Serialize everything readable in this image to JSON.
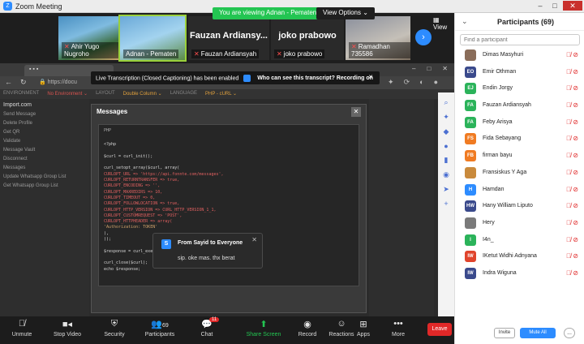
{
  "window": {
    "title": "Zoom Meeting"
  },
  "banner": {
    "viewing": "You are viewing Adnan - Pematen's screen",
    "view_options": "View Options ⌄"
  },
  "gallery": {
    "tiles": [
      {
        "name": "Ahir Yugo Nugroho"
      },
      {
        "name": "Adnan - Pematen"
      },
      {
        "name": "Fauzan Ardiansyah",
        "big": "Fauzan Ardiansy..."
      },
      {
        "name": "joko prabowo",
        "big": "joko prabowo"
      },
      {
        "name": "Ramadhan 735586"
      }
    ],
    "view_label": "View"
  },
  "caption": {
    "text": "Live Transcription (Closed Captioning) has been enabled",
    "link": "Who can see this transcript? Recording on"
  },
  "dialog": {
    "title": "Messages",
    "lang": "PHP",
    "code": [
      "<?php",
      "",
      "$curl = curl_init();",
      "",
      "curl_setopt_array($curl, array(",
      "  CURLOPT_URL => 'https://api.fonnte.com/messages',",
      "  CURLOPT_RETURNTRANSFER => true,",
      "  CURLOPT_ENCODING => '',",
      "  CURLOPT_MAXREDIRS => 10,",
      "  CURLOPT_TIMEOUT => 0,",
      "  CURLOPT_FOLLOWLOCATION => true,",
      "  CURLOPT_HTTP_VERSION => CURL_HTTP_VERSION_1_1,",
      "  CURLOPT_CUSTOMREQUEST => 'POST',",
      "  CURLOPT_HTTPHEADER => array(",
      "    'Authorization: TOKEN'",
      "  ),",
      "));",
      "",
      "$response = curl_exec($curl);",
      "",
      "curl_close($curl);",
      "echo $response;"
    ]
  },
  "postman_left": [
    "Import.com",
    "Send Message",
    "Delete Profile",
    "Get QR",
    "Validate",
    "Message Vault",
    "Disconnect",
    "Messages",
    "Update Whatsapp Group List",
    "Get Whatsapp Group List"
  ],
  "chat_toast": {
    "from": "From Sayid to Everyone",
    "message": "sip. oke mas. thx berat",
    "avatar": "S"
  },
  "toolbar": {
    "unmute": "Unmute",
    "stop_video": "Stop Video",
    "security": "Security",
    "participants": "Participants",
    "participants_count": "69",
    "chat": "Chat",
    "chat_badge": "11",
    "share_screen": "Share Screen",
    "record": "Record",
    "reactions": "Reactions",
    "apps": "Apps",
    "more": "More",
    "leave": "Leave"
  },
  "participants_panel": {
    "title": "Participants (69)",
    "search_placeholder": "Find a participant",
    "list": [
      {
        "initials": "",
        "name": "Dimas Masyhuri",
        "color": "#8a6d5a"
      },
      {
        "initials": "EO",
        "name": "Emir Othman",
        "color": "#3a4a8c"
      },
      {
        "initials": "EJ",
        "name": "Endin Jorgy",
        "color": "#2bb35a"
      },
      {
        "initials": "FA",
        "name": "Fauzan Ardiansyah",
        "color": "#2bb35a"
      },
      {
        "initials": "FA",
        "name": "Feby Arisya",
        "color": "#2bb35a"
      },
      {
        "initials": "FS",
        "name": "Fida Sebayang",
        "color": "#f07b22"
      },
      {
        "initials": "FB",
        "name": "firman bayu",
        "color": "#f07b22"
      },
      {
        "initials": "",
        "name": "Fransiskus Y Aga",
        "color": "#c98a3c"
      },
      {
        "initials": "H",
        "name": "Hamdan",
        "color": "#2d8cff"
      },
      {
        "initials": "HW",
        "name": "Hany William Liputo",
        "color": "#3a4a8c"
      },
      {
        "initials": "",
        "name": "Hery",
        "color": "#7a7a7a"
      },
      {
        "initials": "I",
        "name": "I4n_",
        "color": "#2bb35a"
      },
      {
        "initials": "IW",
        "name": "IKetut Widhi Adnyana",
        "color": "#e0442c"
      },
      {
        "initials": "IW",
        "name": "Indra Wiguna",
        "color": "#3a4a8c"
      }
    ],
    "invite": "Invite",
    "mute_all": "Mute All",
    "more": "..."
  }
}
